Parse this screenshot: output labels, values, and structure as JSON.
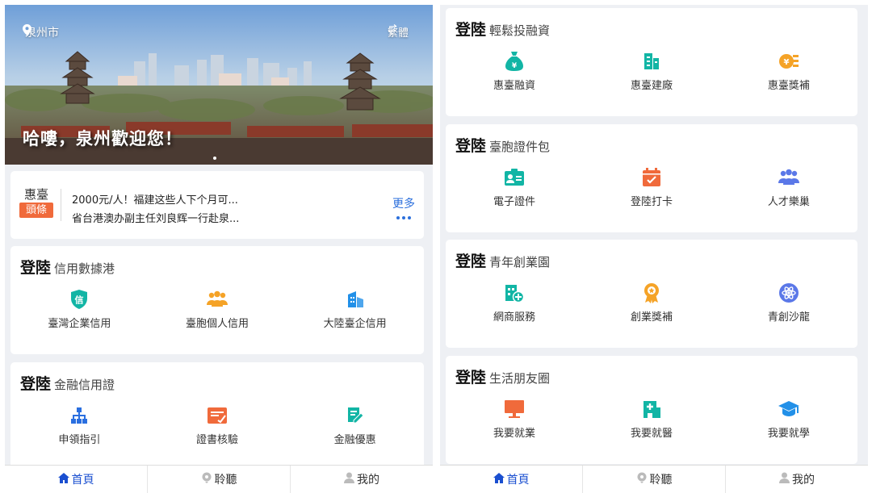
{
  "colors": {
    "accent": "#1a4fd0",
    "green": "#12b5a5",
    "orange": "#f5a327",
    "blue": "#2290e8",
    "red": "#f06a3b",
    "purple": "#5b78e8"
  },
  "left": {
    "header": {
      "location": "泉州市",
      "lang": "繁體",
      "welcome": "哈嘍，泉州歡迎您！"
    },
    "news": {
      "brand_top": "惠臺",
      "brand_bottom": "頭條",
      "lines": [
        "2000元/人！福建这些人下个月可...",
        "省台港澳办副主任刘良辉一行赴泉..."
      ],
      "more": "更多"
    },
    "sections": [
      {
        "prefix": "登陸",
        "title": "信用數據港",
        "items": [
          {
            "label": "臺灣企業信用",
            "icon": "shield-xin-icon"
          },
          {
            "label": "臺胞個人信用",
            "icon": "people-group-icon"
          },
          {
            "label": "大陸臺企信用",
            "icon": "building-icon"
          }
        ]
      },
      {
        "prefix": "登陸",
        "title": "金融信用證",
        "items": [
          {
            "label": "申領指引",
            "icon": "org-chart-icon"
          },
          {
            "label": "證書核驗",
            "icon": "certificate-icon"
          },
          {
            "label": "金融優惠",
            "icon": "edit-doc-icon"
          }
        ]
      }
    ]
  },
  "right": {
    "sections": [
      {
        "prefix": "登陸",
        "title": "輕鬆投融資",
        "items": [
          {
            "label": "惠臺融資",
            "icon": "money-bag-icon"
          },
          {
            "label": "惠臺建廠",
            "icon": "factory-building-icon"
          },
          {
            "label": "惠臺獎補",
            "icon": "coin-subsidy-icon"
          }
        ]
      },
      {
        "prefix": "登陸",
        "title": "臺胞證件包",
        "items": [
          {
            "label": "電子證件",
            "icon": "id-card-icon"
          },
          {
            "label": "登陸打卡",
            "icon": "calendar-check-icon"
          },
          {
            "label": "人才樂巢",
            "icon": "people-group-icon"
          }
        ]
      },
      {
        "prefix": "登陸",
        "title": "青年創業園",
        "items": [
          {
            "label": "網商服務",
            "icon": "shop-plus-icon"
          },
          {
            "label": "創業獎補",
            "icon": "medal-icon"
          },
          {
            "label": "青創沙龍",
            "icon": "atom-icon"
          }
        ]
      },
      {
        "prefix": "登陸",
        "title": "生活朋友圈",
        "items": [
          {
            "label": "我要就業",
            "icon": "monitor-icon"
          },
          {
            "label": "我要就醫",
            "icon": "hospital-icon"
          },
          {
            "label": "我要就學",
            "icon": "graduation-cap-icon"
          }
        ]
      }
    ]
  },
  "tabbar": {
    "home": "首頁",
    "listen": "聆聽",
    "mine": "我的"
  }
}
